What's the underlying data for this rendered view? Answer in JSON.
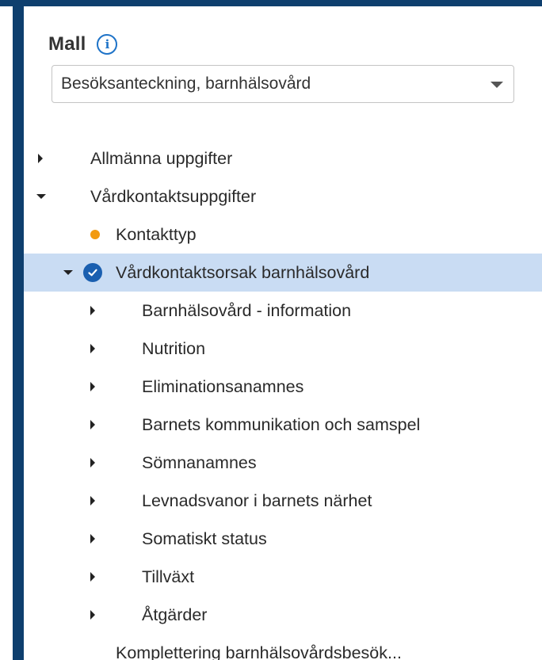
{
  "panel": {
    "title": "Mall",
    "info_icon": "info-icon",
    "template_select": {
      "value": "Besöksanteckning, barnhälsovård"
    }
  },
  "tree": {
    "items": [
      {
        "label": "Allmänna uppgifter",
        "state": "collapsed"
      },
      {
        "label": "Vårdkontaktsuppgifter",
        "state": "expanded"
      },
      {
        "label": "Kontakttyp",
        "status": "incomplete"
      },
      {
        "label": "Vårdkontaktsorsak barnhälsovård",
        "state": "expanded",
        "status": "complete",
        "selected": true
      },
      {
        "label": "Barnhälsovård - information",
        "state": "collapsed"
      },
      {
        "label": "Nutrition",
        "state": "collapsed"
      },
      {
        "label": "Eliminationsanamnes",
        "state": "collapsed"
      },
      {
        "label": "Barnets kommunikation och samspel",
        "state": "collapsed"
      },
      {
        "label": "Sömnanamnes",
        "state": "collapsed"
      },
      {
        "label": "Levnadsvanor i barnets närhet",
        "state": "collapsed"
      },
      {
        "label": "Somatiskt status",
        "state": "collapsed"
      },
      {
        "label": "Tillväxt",
        "state": "collapsed"
      },
      {
        "label": "Åtgärder",
        "state": "collapsed"
      },
      {
        "label": "Komplettering barnhälsovårdsbesök..."
      }
    ]
  },
  "colors": {
    "frame": "#0e3f6e",
    "selected_row": "#c9dcf3",
    "accent": "#1e73c8",
    "check": "#1a5fb0",
    "incomplete_dot": "#f29a10"
  }
}
